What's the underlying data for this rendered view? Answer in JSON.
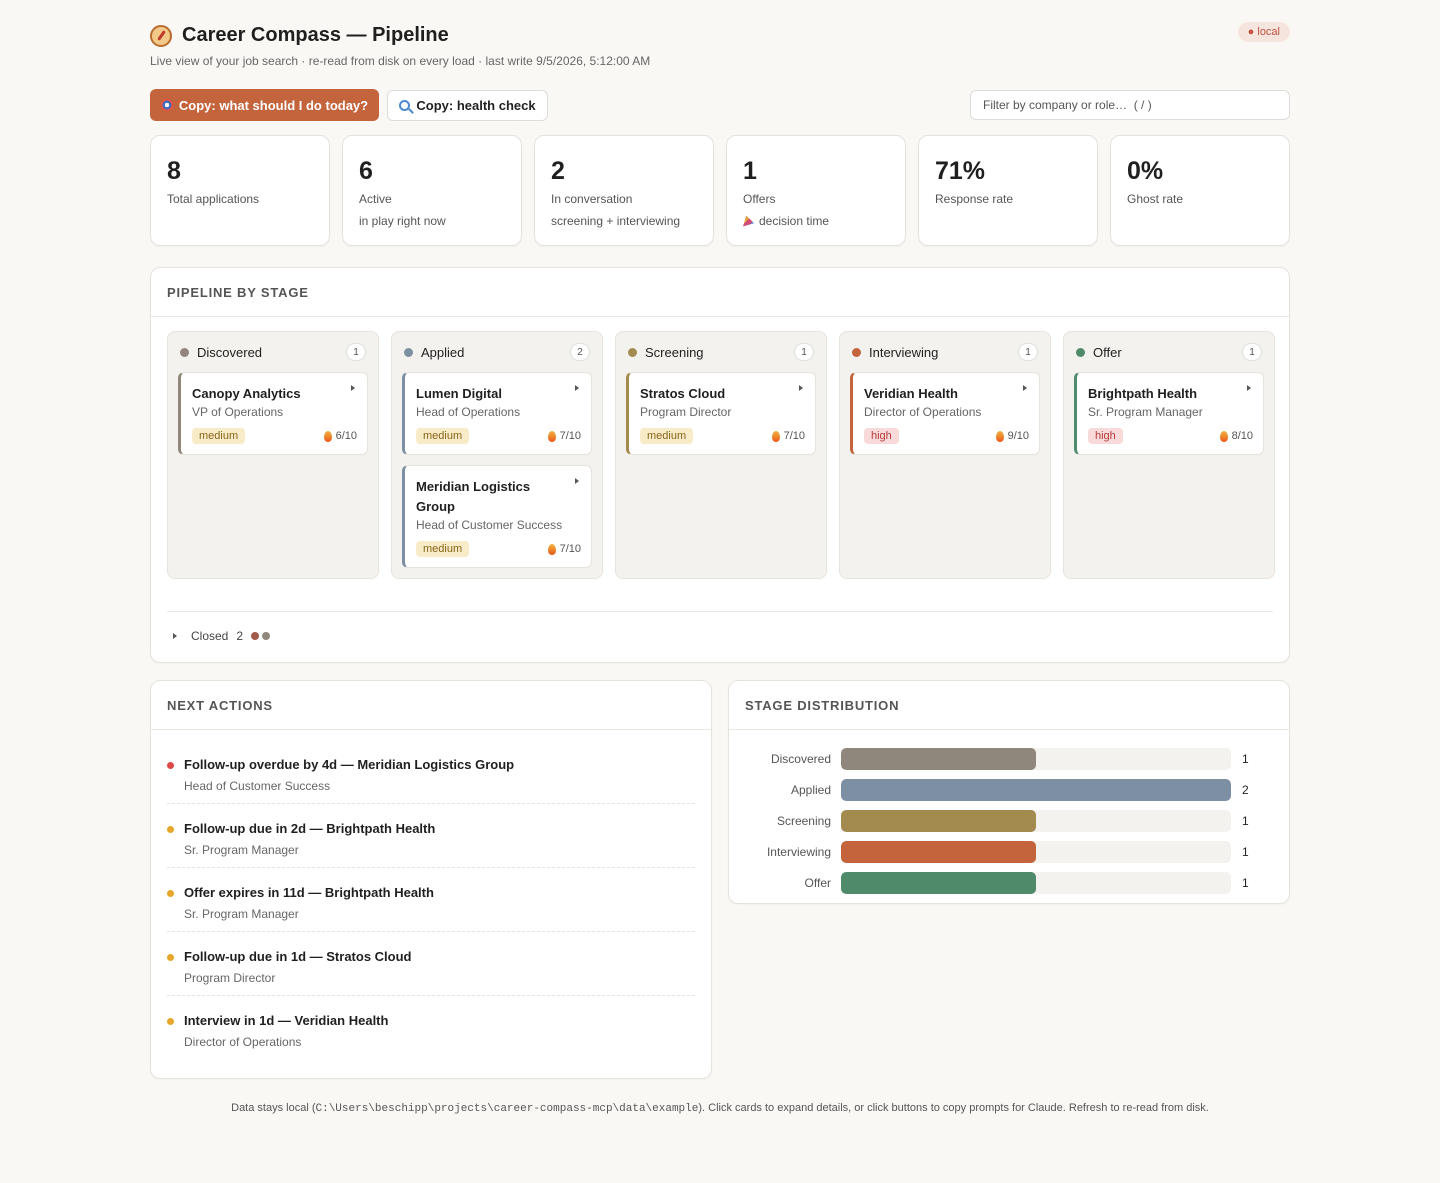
{
  "header": {
    "title": "Career Compass — Pipeline",
    "subtitle": "Live view of your job search · re-read from disk on every load · last write 9/5/2026, 5:12:00 AM",
    "badge": "● local"
  },
  "toolbar": {
    "primary_label": "Copy: what should I do today?",
    "secondary_label": "Copy: health check",
    "filter_placeholder": "Filter by company or role…  ( / )"
  },
  "stats": [
    {
      "value": "8",
      "label": "Total applications",
      "sub": ""
    },
    {
      "value": "6",
      "label": "Active",
      "sub": "in play right now"
    },
    {
      "value": "2",
      "label": "In conversation",
      "sub": "screening + interviewing"
    },
    {
      "value": "1",
      "label": "Offers",
      "sub": "decision time"
    },
    {
      "value": "71%",
      "label": "Response rate",
      "sub": ""
    },
    {
      "value": "0%",
      "label": "Ghost rate",
      "sub": ""
    }
  ],
  "pipeline": {
    "heading": "PIPELINE BY STAGE",
    "columns": [
      {
        "name": "Discovered",
        "count": "1",
        "color": "#8f877b",
        "cards": [
          {
            "company": "Canopy Analytics",
            "role": "VP of Operations",
            "priority": "medium",
            "score": "6/10"
          }
        ]
      },
      {
        "name": "Applied",
        "count": "2",
        "color": "#7d8fa3",
        "cards": [
          {
            "company": "Lumen Digital",
            "role": "Head of Operations",
            "priority": "medium",
            "score": "7/10"
          },
          {
            "company": "Meridian Logistics Group",
            "role": "Head of Customer Success",
            "priority": "medium",
            "score": "7/10"
          }
        ]
      },
      {
        "name": "Screening",
        "count": "1",
        "color": "#a38a4e",
        "cards": [
          {
            "company": "Stratos Cloud",
            "role": "Program Director",
            "priority": "medium",
            "score": "7/10"
          }
        ]
      },
      {
        "name": "Interviewing",
        "count": "1",
        "color": "#c4643d",
        "cards": [
          {
            "company": "Veridian Health",
            "role": "Director of Operations",
            "priority": "high",
            "score": "9/10"
          }
        ]
      },
      {
        "name": "Offer",
        "count": "1",
        "color": "#4f8a6a",
        "cards": [
          {
            "company": "Brightpath Health",
            "role": "Sr. Program Manager",
            "priority": "high",
            "score": "8/10"
          }
        ]
      }
    ],
    "closed_label": "Closed",
    "closed_count": "2",
    "closed_dot_colors": [
      "#a25a4a",
      "#8f877b"
    ]
  },
  "next_actions": {
    "heading": "NEXT ACTIONS",
    "items": [
      {
        "title": "Follow-up overdue by 4d — Meridian Logistics Group",
        "sub": "Head of Customer Success",
        "color": "#e04848"
      },
      {
        "title": "Follow-up due in 2d — Brightpath Health",
        "sub": "Sr. Program Manager",
        "color": "#e8a72a"
      },
      {
        "title": "Offer expires in 11d — Brightpath Health",
        "sub": "Sr. Program Manager",
        "color": "#e8a72a"
      },
      {
        "title": "Follow-up due in 1d — Stratos Cloud",
        "sub": "Program Director",
        "color": "#e8a72a"
      },
      {
        "title": "Interview in 1d — Veridian Health",
        "sub": "Director of Operations",
        "color": "#e8a72a"
      }
    ]
  },
  "distribution": {
    "heading": "STAGE DISTRIBUTION",
    "max": 2,
    "rows": [
      {
        "label": "Discovered",
        "value": 1,
        "color": "#8f877b"
      },
      {
        "label": "Applied",
        "value": 2,
        "color": "#7d8fa3"
      },
      {
        "label": "Screening",
        "value": 1,
        "color": "#a38a4e"
      },
      {
        "label": "Interviewing",
        "value": 1,
        "color": "#c4643d"
      },
      {
        "label": "Offer",
        "value": 1,
        "color": "#4f8a6a"
      }
    ]
  },
  "footer": {
    "prefix": "Data stays local (",
    "path": "C:\\Users\\beschipp\\projects\\career-compass-mcp\\data\\example",
    "suffix": "). Click cards to expand details, or click buttons to copy prompts for Claude. Refresh to re-read from disk."
  }
}
